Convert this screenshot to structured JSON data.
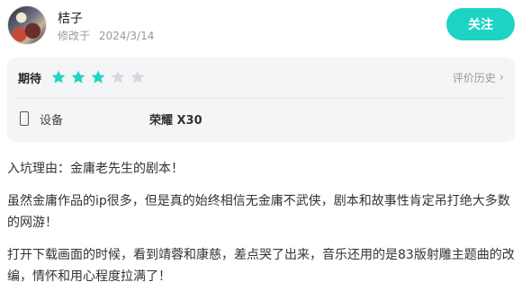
{
  "user": {
    "name": "桔子",
    "modified_label": "修改于",
    "modified_date": "2024/3/14"
  },
  "follow_button": "关注",
  "review_card": {
    "rating_label": "期待",
    "rating_value": 3,
    "rating_max": 5,
    "history_link": "评价历史",
    "device_label": "设备",
    "device_value": "荣耀 X30",
    "colors": {
      "star_filled": "#1dd3c3",
      "star_empty": "#d7d9dc",
      "accent": "#1dd3c3"
    }
  },
  "review": {
    "paragraphs": [
      "入坑理由：金庸老先生的剧本！",
      "虽然金庸作品的ip很多，但是真的始终相信无金庸不武侠，剧本和故事性肯定吊打绝大多数的网游！",
      "打开下载画面的时候，看到靖蓉和康慈，差点哭了出来，音乐还用的是83版射雕主题曲的改编，情怀和用心程度拉满了！"
    ]
  }
}
